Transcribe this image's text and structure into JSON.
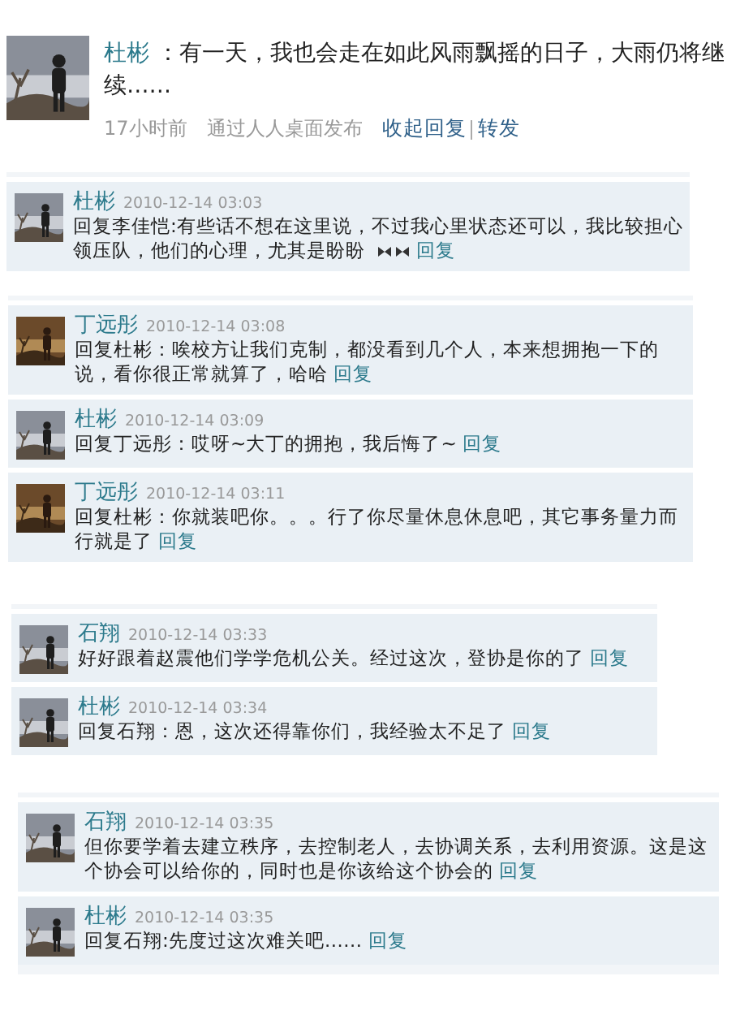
{
  "post": {
    "author": "杜彬",
    "text": "：有一天，我也会走在如此风雨飘摇的日子，大雨仍将继续……",
    "time": "17小时前",
    "source": "通过人人桌面发布",
    "actions": [
      "收起回复",
      "转发"
    ]
  },
  "threads": [
    {
      "comments": [
        {
          "author": "杜彬",
          "time": "2010-12-14 03:03",
          "text": "回复李佳恺:有些话不想在这里说，不过我心里状态还可以，我比较担心领压队，他们的心理，尤其是盼盼",
          "emoticon": true,
          "reply": "回复"
        }
      ]
    },
    {
      "comments": [
        {
          "author": "丁远彤",
          "time": "2010-12-14 03:08",
          "text": "回复杜彬：唉校方让我们克制，都没看到几个人，本来想拥抱一下的说，看你很正常就算了，哈哈",
          "emoticon": false,
          "reply": "回复"
        },
        {
          "author": "杜彬",
          "time": "2010-12-14 03:09",
          "text": "回复丁远彤：哎呀~大丁的拥抱，我后悔了~",
          "emoticon": false,
          "reply": "回复"
        },
        {
          "author": "丁远彤",
          "time": "2010-12-14 03:11",
          "text": "回复杜彬：你就装吧你。。。行了你尽量休息休息吧，其它事务量力而行就是了",
          "emoticon": false,
          "reply": "回复"
        }
      ]
    },
    {
      "comments": [
        {
          "author": "石翔",
          "time": "2010-12-14 03:33",
          "text": "好好跟着赵震他们学学危机公关。经过这次，登协是你的了",
          "emoticon": false,
          "reply": "回复"
        },
        {
          "author": "杜彬",
          "time": "2010-12-14 03:34",
          "text": "回复石翔：恩，这次还得靠你们，我经验太不足了",
          "emoticon": false,
          "reply": "回复"
        }
      ]
    },
    {
      "comments": [
        {
          "author": "石翔",
          "time": "2010-12-14 03:35",
          "text": "但你要学着去建立秩序，去控制老人，去协调关系，去利用资源。这是这个协会可以给你的，同时也是你该给这个协会的",
          "emoticon": false,
          "reply": "回复"
        },
        {
          "author": "杜彬",
          "time": "2010-12-14 03:35",
          "text": "回复石翔:先度过这次难关吧……",
          "emoticon": false,
          "reply": "回复"
        }
      ]
    }
  ]
}
